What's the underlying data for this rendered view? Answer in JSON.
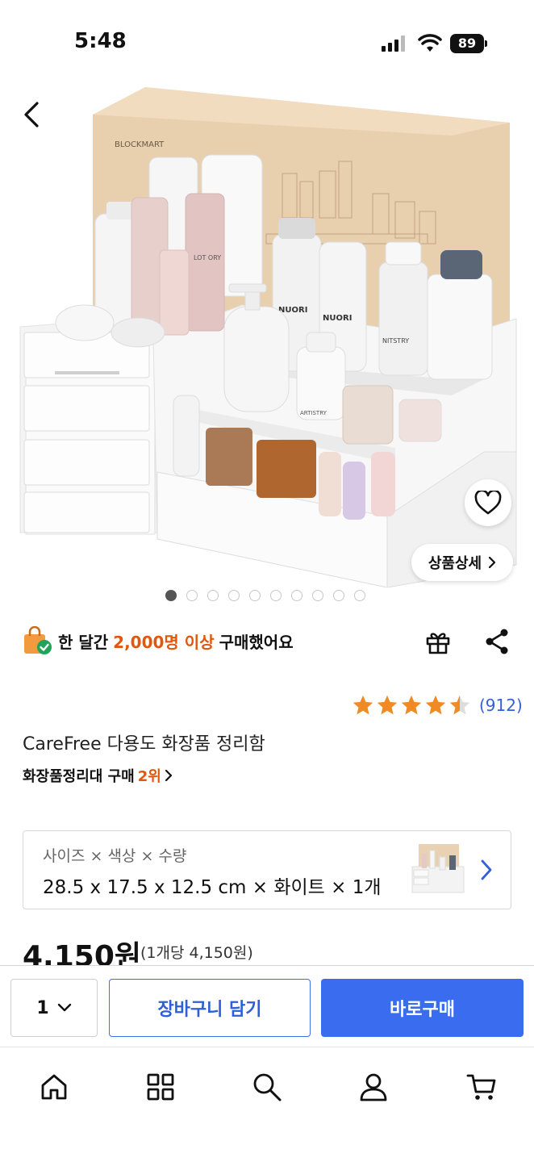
{
  "status_bar": {
    "time": "5:48",
    "battery": "89"
  },
  "product_image": {
    "box_brand": "BLOCKMART",
    "bottle_labels": [
      "NUORI",
      "NUORI",
      "NITSTRY",
      "ARTISTRY",
      "LOT ORY"
    ],
    "current_slide": 1,
    "slide_count": 10
  },
  "buttons": {
    "detail_label": "상품상세"
  },
  "stat": {
    "prefix": "한 달간",
    "highlight": "2,000명 이상",
    "suffix": "구매했어요"
  },
  "rating": {
    "stars": 4.5,
    "count": "(912)"
  },
  "product": {
    "title": "CareFree 다용도 화장품 정리함"
  },
  "rank": {
    "category": "화장품정리대 구매",
    "position": "2위"
  },
  "option": {
    "label": "사이즈 × 색상 × 수량",
    "value": "28.5 x 17.5 x 12.5 cm × 화이트 × 1개"
  },
  "price": {
    "amount": "4,150원",
    "unit": "(1개당 4,150원)"
  },
  "action_bar": {
    "quantity": "1",
    "cart_label": "장바구니 담기",
    "buy_label": "바로구매"
  },
  "nav": {
    "items": [
      "home-icon",
      "category-icon",
      "search-icon",
      "user-icon",
      "cart-icon"
    ]
  },
  "colors": {
    "accent": "#3a6cf0",
    "highlight": "#e0570d",
    "star": "#f08a24"
  }
}
